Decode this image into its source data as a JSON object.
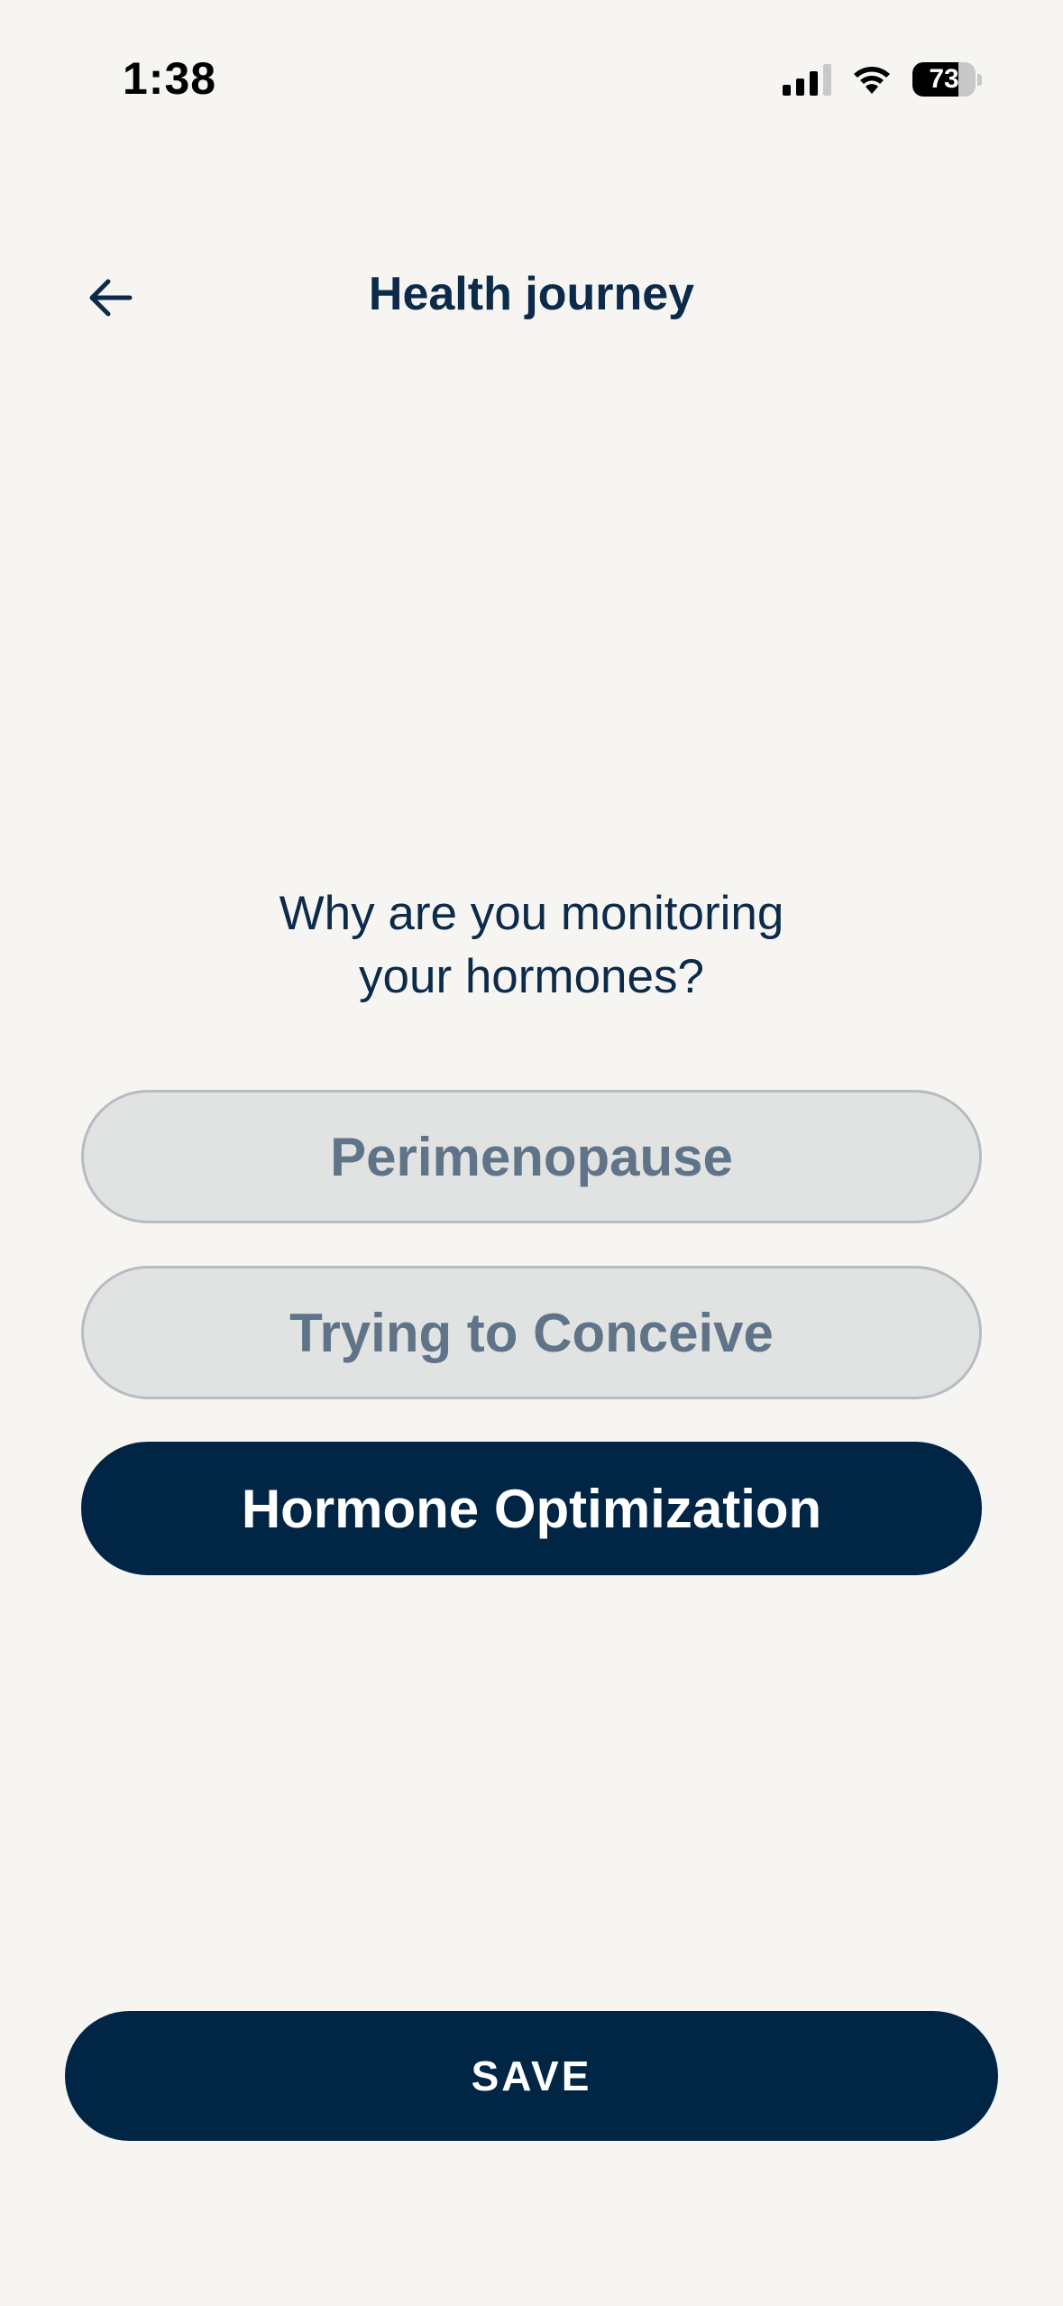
{
  "status_bar": {
    "time": "1:38",
    "battery_level": "73",
    "battery_fraction": 0.73,
    "signal_bars_active": 3,
    "signal_bars_total": 4,
    "icons": [
      "cellular-signal-icon",
      "wifi-icon",
      "battery-icon"
    ]
  },
  "header": {
    "title": "Health journey",
    "back_icon": "arrow-left-icon"
  },
  "question": {
    "text": "Why are you monitoring\nyour hormones?"
  },
  "options": [
    {
      "label": "Perimenopause",
      "selected": false
    },
    {
      "label": "Trying to Conceive",
      "selected": false
    },
    {
      "label": "Hormone Optimization",
      "selected": true
    }
  ],
  "footer": {
    "save_label": "SAVE"
  },
  "colors": {
    "background": "#f7f5f2",
    "primary": "#012545",
    "text": "#0c2a4a",
    "option_unselected_bg": "#e1e2e2",
    "option_unselected_border": "#b6bcc2",
    "option_unselected_text": "#5f7488"
  }
}
